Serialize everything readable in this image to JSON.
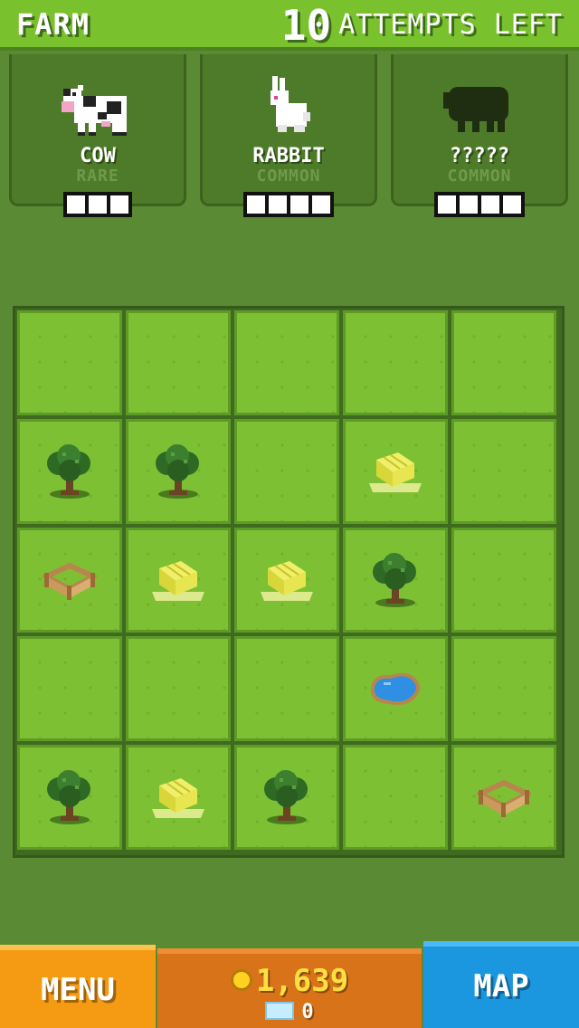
{
  "header": {
    "title": "FARM",
    "attempts_number": "10",
    "attempts_text": "ATTEMPTS LEFT"
  },
  "animals": [
    {
      "name": "COW",
      "rarity": "RARE",
      "icon": "cow-icon",
      "slots": 3
    },
    {
      "name": "RABBIT",
      "rarity": "COMMON",
      "icon": "rabbit-icon",
      "slots": 4
    },
    {
      "name": "?????",
      "rarity": "COMMON",
      "icon": "unknown-animal-silhouette-icon",
      "slots": 4
    }
  ],
  "board": {
    "rows": 5,
    "cols": 5,
    "tiles": [
      [
        "grass",
        "grass",
        "grass",
        "grass",
        "grass"
      ],
      [
        "tree",
        "tree",
        "grass",
        "hay",
        "grass"
      ],
      [
        "fence",
        "hay",
        "hay",
        "tree",
        "grass"
      ],
      [
        "grass",
        "grass",
        "grass",
        "pond",
        "grass"
      ],
      [
        "tree",
        "hay",
        "tree",
        "grass",
        "fence"
      ]
    ]
  },
  "footer": {
    "menu_label": "MENU",
    "coins": "1,639",
    "tickets": "0",
    "map_label": "MAP"
  },
  "colors": {
    "background": "#5a8a34",
    "tile": "#7dc033",
    "menu_button": "#f59a13",
    "money_panel": "#d9731a",
    "map_button": "#1b97e0",
    "coin": "#ffe040"
  }
}
